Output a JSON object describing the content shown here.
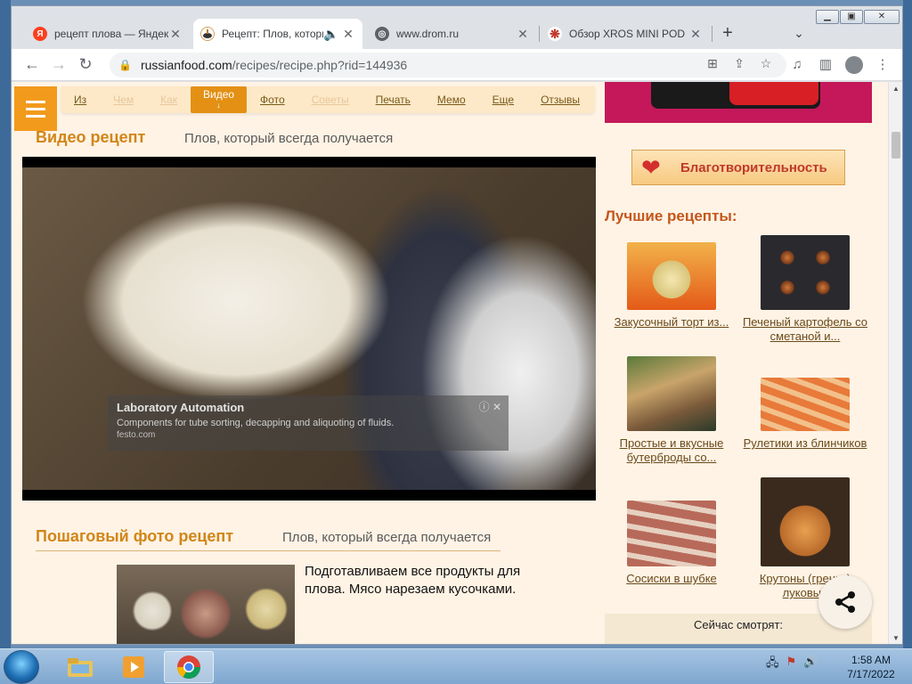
{
  "browser": {
    "tabs": [
      {
        "title": "рецепт плова — Яндекс",
        "icon": "yandex-icon",
        "active": false
      },
      {
        "title": "Рецепт: Плов, который всегда получается",
        "icon": "russianfood-icon",
        "active": true,
        "audio": true
      },
      {
        "title": "www.drom.ru",
        "icon": "globe-icon",
        "active": false
      },
      {
        "title": "Обзор XROS MINI POD",
        "icon": "site-icon",
        "active": false
      }
    ],
    "new_tab": "+",
    "url_host": "russianfood.com",
    "url_path": "/recipes/recipe.php?rid=144936"
  },
  "site": {
    "nav": [
      {
        "label": "Из",
        "state": "normal"
      },
      {
        "label": "Чем",
        "state": "faded"
      },
      {
        "label": "Как",
        "state": "faded"
      },
      {
        "label": "Видео",
        "state": "active",
        "sub": "↓"
      },
      {
        "label": "Фото",
        "state": "normal"
      },
      {
        "label": "Советы",
        "state": "faded"
      },
      {
        "label": "Печать",
        "state": "normal"
      },
      {
        "label": "Мемо",
        "state": "normal"
      },
      {
        "label": "Еще",
        "state": "normal"
      },
      {
        "label": "Отзывы",
        "state": "normal"
      }
    ],
    "video_section": {
      "title": "Видео рецепт",
      "subtitle": "Плов, который всегда получается"
    },
    "ad": {
      "title": "Laboratory Automation",
      "desc": "Components for tube sorting, decapping and aliquoting of fluids.",
      "source": "festo.com"
    },
    "photo_section": {
      "title": "Пошаговый фото рецепт",
      "subtitle": "Плов, который всегда получается"
    },
    "step_text": "Подготавливаем все продукты для плова. Мясо нарезаем кусочками.",
    "charity": "Благотворительность",
    "best_title": "Лучшие рецепты:",
    "recipes": [
      {
        "label": "Закусочный торт из..."
      },
      {
        "label": "Печеный картофель со сметаной и..."
      },
      {
        "label": "Простые и вкусные бутерброды со..."
      },
      {
        "label": "Рулетики из блинчиков"
      },
      {
        "label": "Сосиски в шубке"
      },
      {
        "label": "Крутоны (гренки) луковые"
      }
    ],
    "watching": "Сейчас смотрят:"
  },
  "taskbar": {
    "time": "1:58 AM",
    "date": "7/17/2022"
  }
}
